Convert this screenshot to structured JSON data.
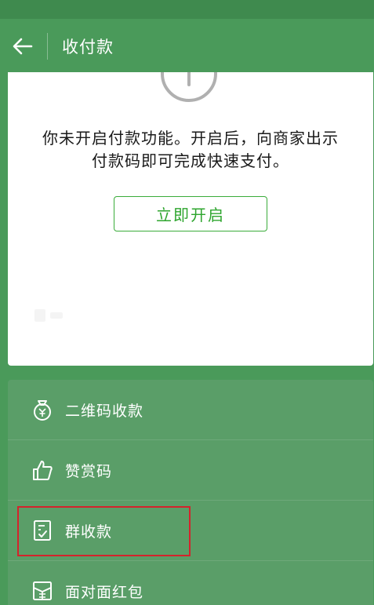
{
  "header": {
    "title": "收付款"
  },
  "card": {
    "message_line1": "你未开启付款功能。开启后，向商家出示",
    "message_line2": "付款码即可完成快速支付。",
    "enable_button": "立即开启"
  },
  "menu": {
    "items": [
      {
        "label": "二维码收款",
        "icon": "money-bag-icon"
      },
      {
        "label": "赞赏码",
        "icon": "thumbs-up-icon"
      },
      {
        "label": "群收款",
        "icon": "group-bill-icon",
        "highlighted": true
      },
      {
        "label": "面对面红包",
        "icon": "red-packet-icon"
      }
    ]
  },
  "colors": {
    "background": "#4a9a5a",
    "panel": "#5a9e68",
    "accent": "#2ea52e",
    "highlight": "#d4232c"
  }
}
